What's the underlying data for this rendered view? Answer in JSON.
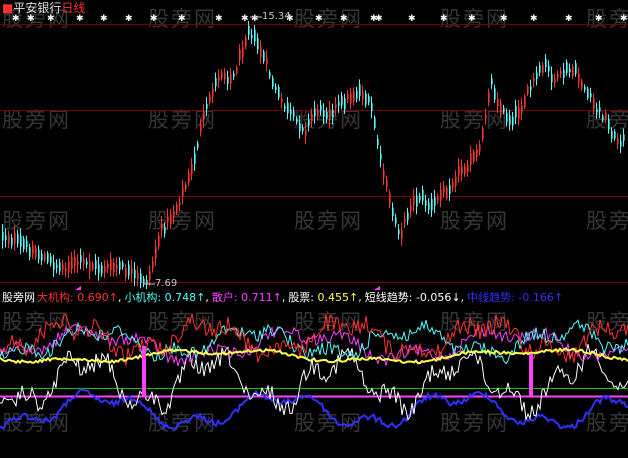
{
  "header": {
    "prefix": "■",
    "stock_name": "平安银行",
    "period": "日线",
    "colors": {
      "prefix": "#ff3030",
      "stock_name": "#e0e0e0",
      "period": "#ff3030"
    }
  },
  "price_panel": {
    "high_label": "15.34",
    "low_label": "7.69",
    "colors": {
      "up": "#ff3232",
      "down": "#54fcfc",
      "grid": "#7a0000",
      "star": "#ffffff",
      "arrow": "#ff40ff"
    }
  },
  "indicator_header": {
    "name": "股旁网",
    "items": [
      {
        "label": "大机构:",
        "value": "0.690",
        "arrow": "↑",
        "color": "#ff3232",
        "label_color": "#ff3232"
      },
      {
        "label": "小机构:",
        "value": "0.748",
        "arrow": "↑",
        "color": "#54fcfc",
        "label_color": "#54fcfc"
      },
      {
        "label": "散户:",
        "value": "0.711",
        "arrow": "↑",
        "color": "#ff40ff",
        "label_color": "#ff40ff"
      },
      {
        "label": "股票:",
        "value": "0.455",
        "arrow": "↑",
        "color": "#ffff54",
        "label_color": "#ffffff"
      },
      {
        "label": "短线趋势:",
        "value": "-0.056",
        "arrow": "↓",
        "color": "#ffffff",
        "label_color": "#ffffff"
      },
      {
        "label": "中线趋势:",
        "value": "-0.166",
        "arrow": "↑",
        "color": "#3030ff",
        "label_color": "#3030ff"
      }
    ]
  },
  "watermark": "股旁网",
  "icons": {
    "star": "star-icon",
    "arrow": "triangle-arrow-icon"
  }
}
